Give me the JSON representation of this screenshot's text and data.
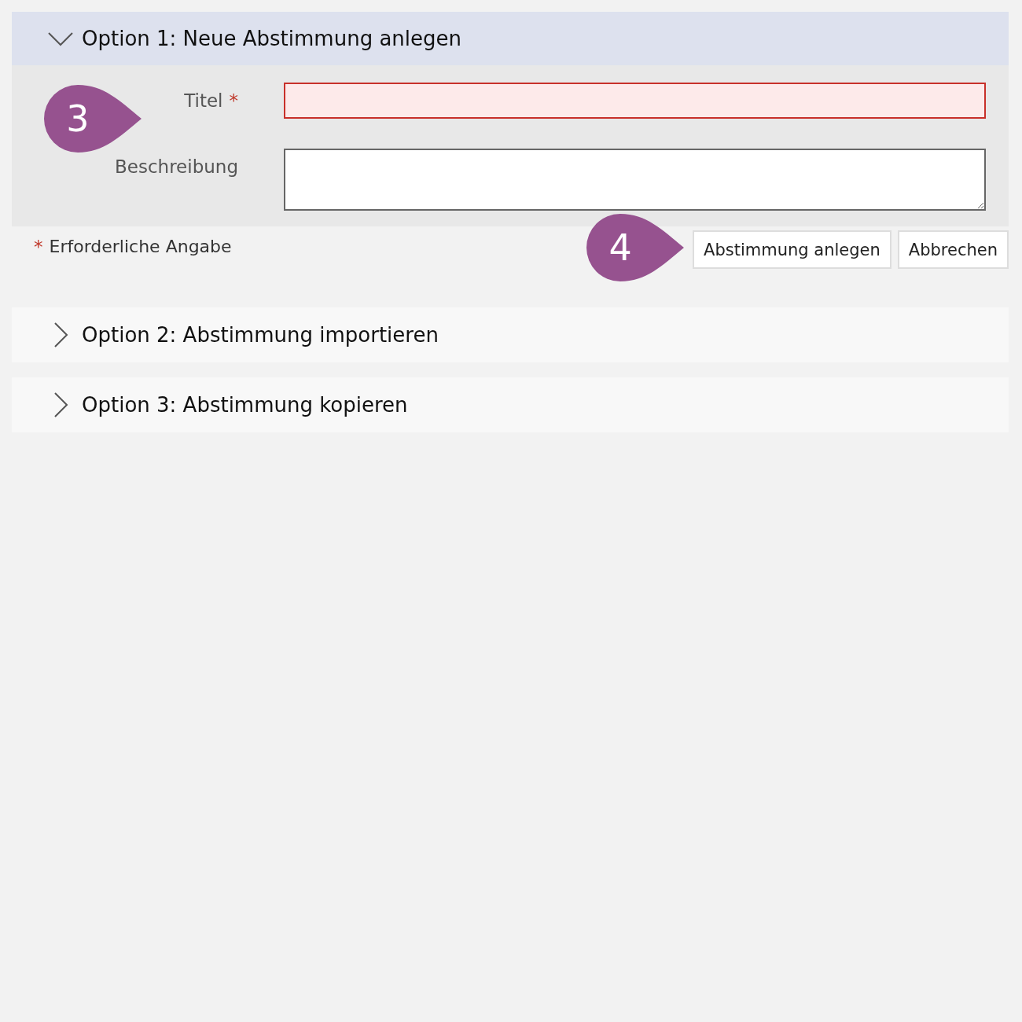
{
  "sections": [
    {
      "title": "Option 1: Neue Abstimmung anlegen",
      "expanded": true
    },
    {
      "title": "Option 2: Abstimmung importieren",
      "expanded": false
    },
    {
      "title": "Option 3: Abstimmung kopieren",
      "expanded": false
    }
  ],
  "form": {
    "required_mark": "*",
    "fields": [
      {
        "label": "Titel",
        "required": true,
        "kind": "input",
        "invalid": true
      },
      {
        "label": "Beschreibung",
        "required": false,
        "kind": "textarea",
        "invalid": false
      }
    ],
    "note": {
      "mark": "*",
      "text": "Erforderliche Angabe"
    },
    "buttons": [
      "Abstimmung anlegen",
      "Abbrechen"
    ]
  },
  "callouts": [
    {
      "number": "3"
    },
    {
      "number": "4"
    }
  ]
}
